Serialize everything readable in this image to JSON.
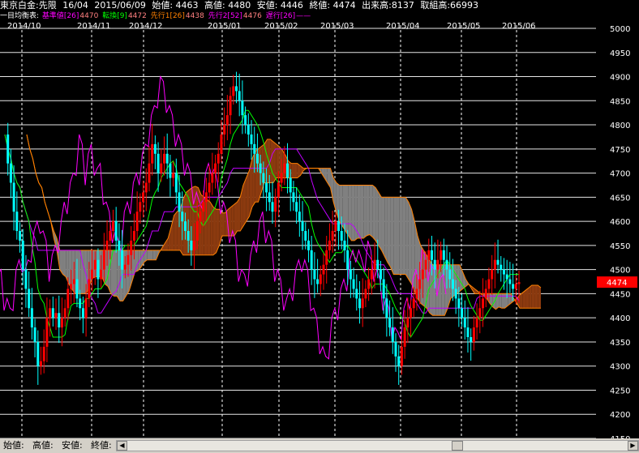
{
  "header": {
    "title": "東京白金:先限",
    "contract": "16/04",
    "date": "2015/06/09",
    "open": "始値: 4463",
    "high": "高値: 4480",
    "low": "安値: 4446",
    "close": "終値: 4474",
    "volume": "出来高:8137",
    "open_interest": "取組高:66993"
  },
  "legend": {
    "prefix": "一目均衡表:",
    "items": [
      {
        "label": "基準値[26]",
        "value": "4470",
        "color": "#ff00ff",
        "name": "kijun"
      },
      {
        "label": "転換[9]",
        "value": "4472",
        "color": "#00ff00",
        "name": "tenkan"
      },
      {
        "label": "先行1[26]",
        "value": "4438",
        "color": "#ff8000",
        "name": "senkou1"
      },
      {
        "label": "先行2[52]",
        "value": "4476",
        "color": "#ff00ff",
        "name": "senkou2"
      },
      {
        "label": "遅行[26]",
        "value": "",
        "color": "#ff00ff",
        "name": "chikou"
      }
    ]
  },
  "status": {
    "open_label": "始値:",
    "high_label": "高値:",
    "low_label": "安値:",
    "close_label": "終値:"
  },
  "colors": {
    "up": "#ff0000",
    "down": "#00ffff",
    "cloud_bull": "#8b3a0f",
    "cloud_bear": "#808080",
    "cloud_edge": "#ff8000",
    "kijun": "#ff00ff",
    "tenkan": "#00ff00",
    "chikou": "#ff00ff",
    "last_price_bg": "#ff0000",
    "grid": "#ffffff"
  },
  "chart_data": {
    "type": "candlestick",
    "indicator": "ichimoku",
    "x_ticks": [
      "2014/10",
      "2014/11",
      "2014/12",
      "2015/01",
      "2015/02",
      "2015/03",
      "2015/04",
      "2015/05",
      "2015/06"
    ],
    "y_ticks": [
      5000,
      4950,
      4900,
      4850,
      4800,
      4750,
      4700,
      4650,
      4600,
      4550,
      4500,
      4450,
      4400,
      4350,
      4300,
      4250,
      4200,
      4150
    ],
    "ylim": [
      4150,
      5000
    ],
    "last_price": 4474,
    "last_price_label": "4474",
    "grid": true,
    "price_path": [
      [
        4780,
        4720,
        4680,
        4620,
        4580,
        4560,
        4500,
        4460,
        4420,
        4380,
        4350,
        4300,
        4310,
        4340,
        4400,
        4420,
        4400,
        4410,
        4380,
        4400,
        4420,
        4460,
        4470,
        4480,
        4440,
        4420,
        4400,
        4440,
        4480,
        4500,
        4520,
        4480,
        4500,
        4540,
        4560,
        4580,
        4600,
        4560,
        4540,
        4500,
        4510,
        4530,
        4560,
        4580,
        4620,
        4640,
        4660,
        4680,
        4720,
        4760,
        4740,
        4700,
        4720,
        4740,
        4720,
        4690,
        4700,
        4660,
        4620,
        4600,
        4580,
        4560,
        4540,
        4560,
        4600,
        4620,
        4640,
        4660,
        4680,
        4700,
        4720,
        4740,
        4780,
        4800,
        4820,
        4860,
        4880,
        4870,
        4850,
        4820,
        4800,
        4780,
        4760,
        4740,
        4720,
        4700,
        4680,
        4660,
        4640,
        4620,
        4650,
        4680,
        4700,
        4720,
        4690,
        4660,
        4640,
        4620,
        4600,
        4580,
        4560,
        4540,
        4500,
        4480,
        4470,
        4490,
        4510,
        4540,
        4560,
        4580,
        4600,
        4580,
        4560,
        4540,
        4500,
        4480,
        4460,
        4440,
        4420,
        4440,
        4460,
        4480,
        4500,
        4520,
        4500,
        4480,
        4440,
        4400,
        4380,
        4350,
        4320,
        4300,
        4340,
        4380,
        4400,
        4420,
        4440,
        4460,
        4480,
        4500,
        4520,
        4540,
        4520,
        4500,
        4520,
        4540,
        4520,
        4500,
        4480,
        4460,
        4440,
        4420,
        4400,
        4380,
        4360,
        4350,
        4380,
        4400,
        4420,
        4440,
        4460,
        4480,
        4500,
        4520,
        4510,
        4500,
        4490,
        4480,
        4470,
        4460,
        4470,
        4474
      ]
    ]
  }
}
